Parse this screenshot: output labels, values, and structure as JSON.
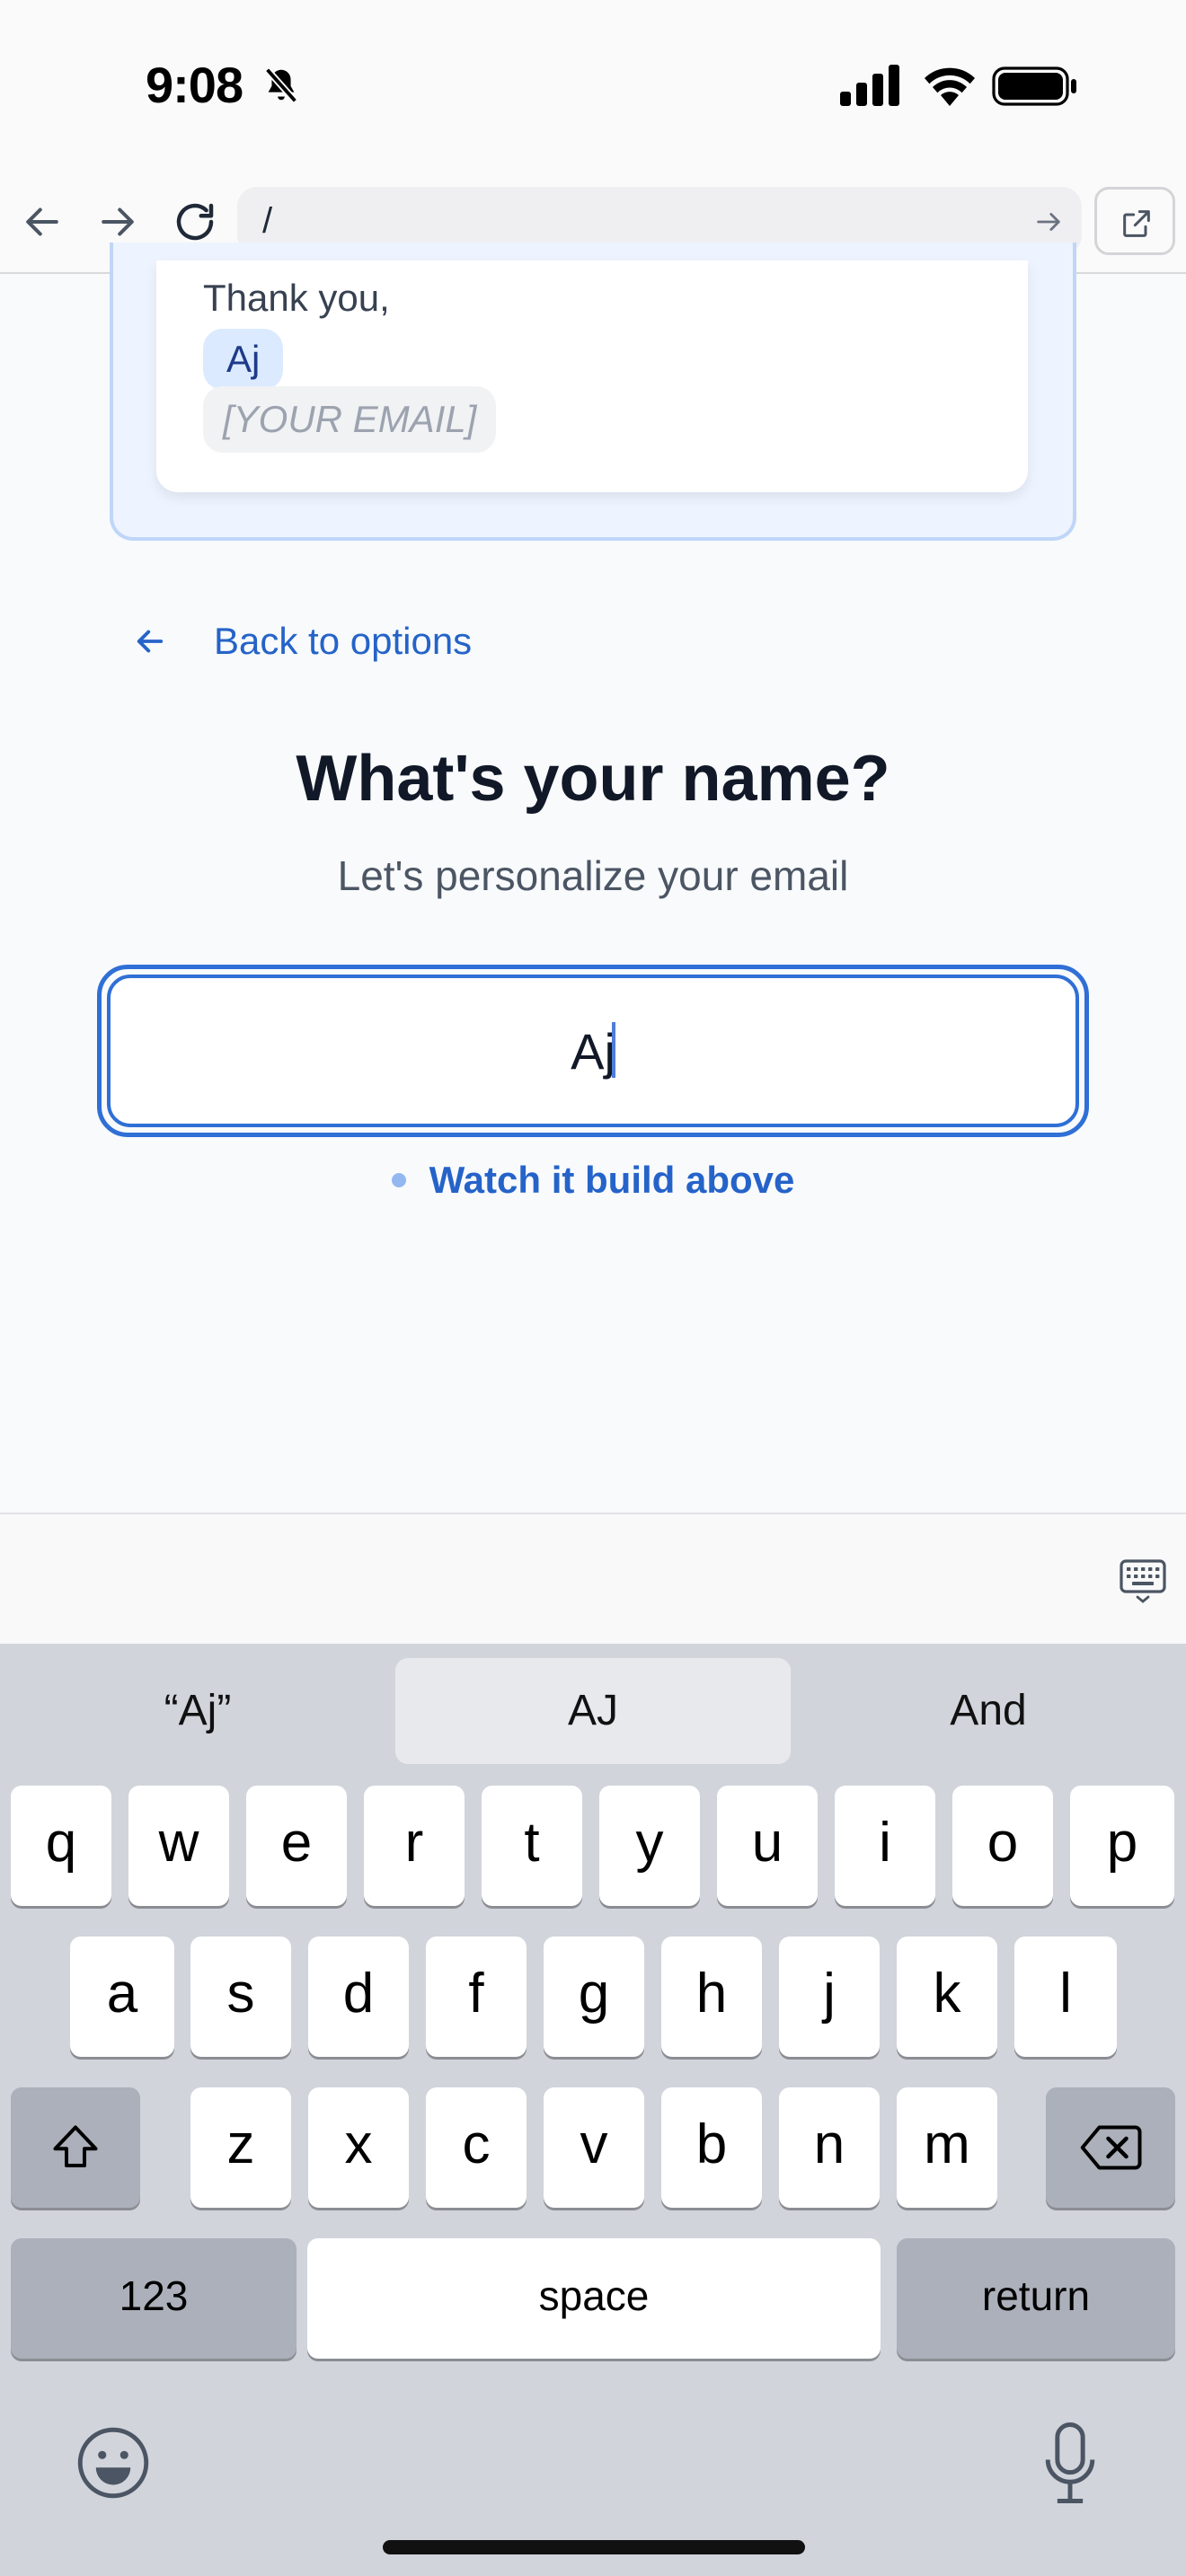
{
  "status_bar": {
    "time": "9:08",
    "icons": [
      "bell-slash-icon",
      "cellular-signal-icon",
      "wifi-icon",
      "battery-icon"
    ]
  },
  "browser": {
    "url": "/",
    "buttons": [
      "back-arrow-icon",
      "forward-arrow-icon",
      "reload-icon",
      "go-arrow-icon",
      "open-external-icon"
    ]
  },
  "preview": {
    "thanks": "Thank you,",
    "name": "Aj",
    "email_placeholder": "[YOUR EMAIL]"
  },
  "back_link": "Back to options",
  "question": {
    "title": "What's your name?",
    "subtitle": "Let's personalize your email"
  },
  "name_input": {
    "value": "Aj"
  },
  "hint": "Watch it build above",
  "keyboard": {
    "suggestions": [
      "“Aj”",
      "AJ",
      "And"
    ],
    "row1": [
      "q",
      "w",
      "e",
      "r",
      "t",
      "y",
      "u",
      "i",
      "o",
      "p"
    ],
    "row2": [
      "a",
      "s",
      "d",
      "f",
      "g",
      "h",
      "j",
      "k",
      "l"
    ],
    "row3": [
      "z",
      "x",
      "c",
      "v",
      "b",
      "n",
      "m"
    ],
    "numbers_label": "123",
    "space_label": "space",
    "return_label": "return"
  },
  "colors": {
    "accent": "#2563c9",
    "input_border": "#2f6fd6",
    "preview_bg": "#eef4ff",
    "name_chip": "#dbeafe"
  }
}
